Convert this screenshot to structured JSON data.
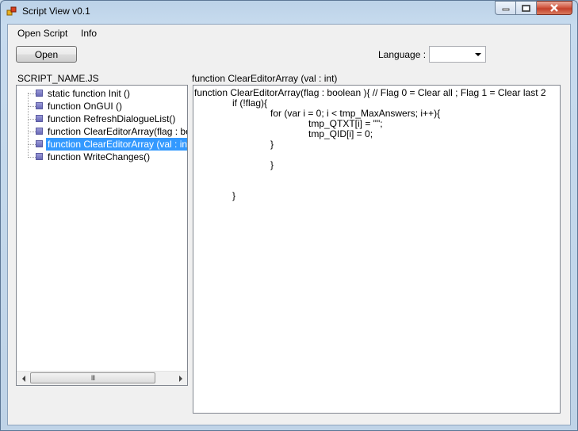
{
  "window": {
    "title": "Script View v0.1"
  },
  "menu": {
    "items": [
      "Open Script",
      "Info"
    ]
  },
  "toolbar": {
    "open_label": "Open",
    "language_label": "Language :",
    "language_value": ""
  },
  "tree": {
    "label": "SCRIPT_NAME.JS",
    "items": [
      "static function Init ()",
      "function OnGUI ()",
      "function RefreshDialogueList()",
      "function ClearEditorArray(flag : boolean)",
      "function ClearEditorArray (val : int)",
      "function WriteChanges()"
    ],
    "selected_index": 4,
    "scroll_grip": "III"
  },
  "editor": {
    "label": "function ClearEditorArray (val : int)",
    "lines": [
      "function ClearEditorArray(flag : boolean ){ // Flag 0 = Clear all ; Flag 1 = Clear last 2",
      "if (!flag){",
      "for (var i = 0; i < tmp_MaxAnswers; i++){",
      "tmp_QTXT[i] = \"\";",
      "tmp_QID[i] = 0;",
      "}",
      "}",
      "}"
    ]
  }
}
